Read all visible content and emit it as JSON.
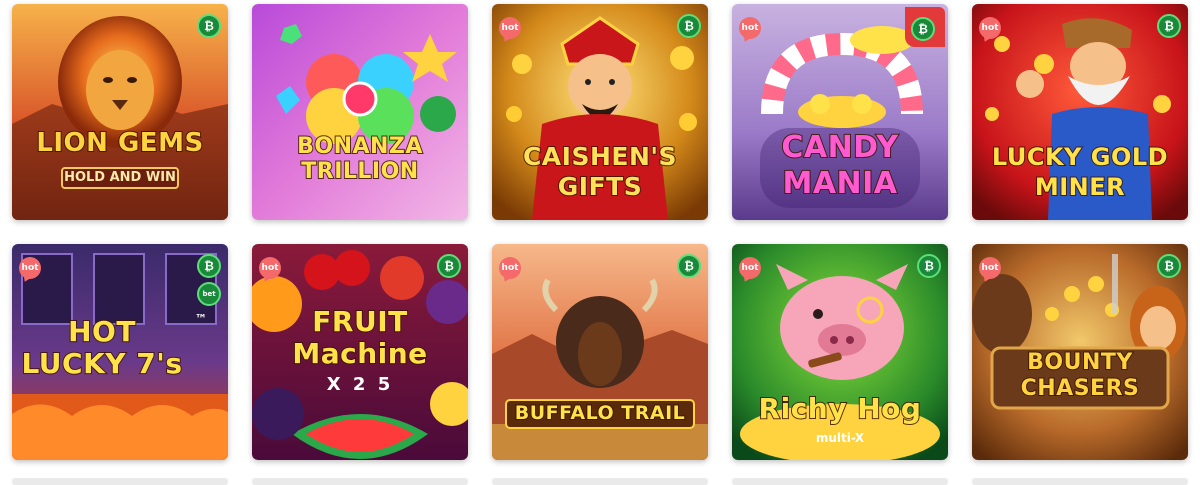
{
  "games": [
    {
      "title": "LION GEMS",
      "subtitle": "HOLD AND WIN",
      "badges": {
        "hot": false,
        "crypto": true
      }
    },
    {
      "title": "BONANZA TRILLION",
      "subtitle": "",
      "badges": {
        "hot": false,
        "crypto": false
      }
    },
    {
      "title": "CAISHEN'S GIFTS",
      "subtitle": "",
      "badges": {
        "hot": true,
        "crypto": true
      }
    },
    {
      "title": "CANDY MANIA",
      "subtitle": "",
      "badges": {
        "hot": true,
        "crypto": true
      }
    },
    {
      "title": "LUCKY GOLD MINER",
      "subtitle": "",
      "badges": {
        "hot": true,
        "crypto": true
      }
    },
    {
      "title": "HOT LUCKY 7's",
      "subtitle": "™",
      "badges": {
        "hot": true,
        "crypto": true,
        "bet": true
      }
    },
    {
      "title": "FRUIT Machine",
      "subtitle": "X 2 5",
      "badges": {
        "hot": true,
        "crypto": true
      }
    },
    {
      "title": "BUFFALO TRAIL",
      "subtitle": "",
      "badges": {
        "hot": true,
        "crypto": true
      }
    },
    {
      "title": "Richy Hog",
      "subtitle": "multi-X",
      "badges": {
        "hot": true,
        "crypto": true
      }
    },
    {
      "title": "BOUNTY CHASERS",
      "subtitle": "",
      "badges": {
        "hot": true,
        "crypto": true
      }
    }
  ],
  "badge_labels": {
    "hot": "hot",
    "crypto": "₿",
    "bet": "bet"
  },
  "colors": {
    "hot_badge": "#f46a6a",
    "crypto_badge": "#1a8a3a",
    "crypto_ring": "#5dde7a"
  },
  "icons": {
    "crypto": "bitcoin-icon",
    "hot": "hot-speech-bubble-icon"
  }
}
